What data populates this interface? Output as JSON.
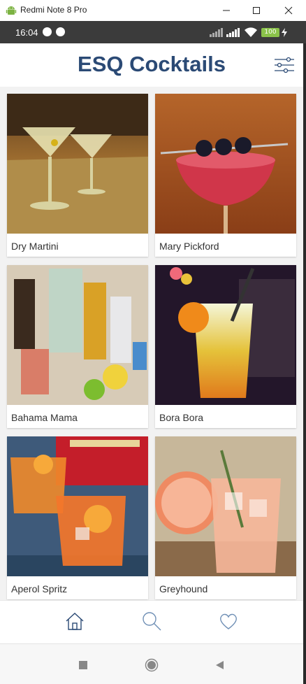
{
  "window": {
    "title": "Redmi Note 8 Pro"
  },
  "status_bar": {
    "time": "16:04",
    "battery": "100"
  },
  "app": {
    "title": "ESQ Cocktails"
  },
  "cocktails": [
    {
      "name": "Dry Martini"
    },
    {
      "name": "Mary Pickford"
    },
    {
      "name": "Bahama Mama"
    },
    {
      "name": "Bora Bora"
    },
    {
      "name": "Aperol Spritz"
    },
    {
      "name": "Greyhound"
    }
  ],
  "colors": {
    "brand": "#2b4a75",
    "nav_icon": "#2b4a75"
  },
  "bottom_nav": {
    "items": [
      "home-icon",
      "search-icon",
      "heart-icon"
    ],
    "active": "home"
  }
}
